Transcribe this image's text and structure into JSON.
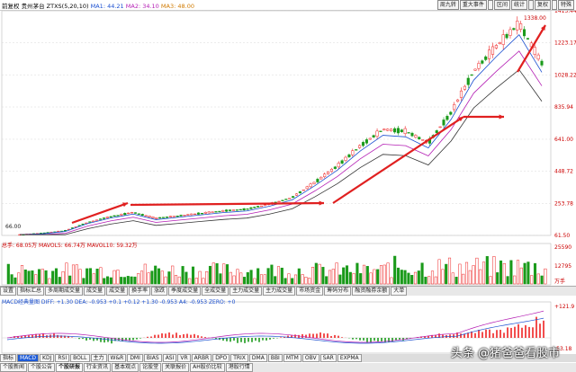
{
  "header": {
    "mode": "前复权",
    "stock": "贵州茅台",
    "ztxs": "ZTXS(5,20,10)",
    "ma1": "MA1: 44.21",
    "ma2": "MA2: 34.10",
    "ma3": "MA3: 48.00",
    "buttons": [
      "周九转",
      "重大事件",
      "",
      "区间",
      "统计",
      "",
      "复权",
      "",
      "特殊"
    ]
  },
  "price_axis": [
    "1415.44",
    "1223.17",
    "1028.22",
    "835.94",
    "641.00",
    "448.72",
    "253.78",
    "61.50"
  ],
  "price_max_label": "1338.00",
  "price_min_label": "66.00",
  "volume_header": "总手: 68.05万  MAVOL5: 66.74万  MAVOL10: 59.32万",
  "volume_axis": [
    "25590",
    "12795"
  ],
  "volume_unit": "万手",
  "macd_header": "MACD经典量图  DIFF: +1.30  DEA: -0.953  +0.1  +0.12  +1.30  -0.953  A4: -0.953  ZERO: +0",
  "macd_axis": [
    "+121.9",
    "-53.18"
  ],
  "tabs1": [
    "设置",
    "指标汇总",
    "多周期成交量",
    "成交量",
    "成交量",
    "换手率",
    "涨跌",
    "季度成交量",
    "全成交量",
    "主力成交量",
    "主力成交量",
    "市场资金",
    "筹码分布",
    "融资融券余额",
    "大单"
  ],
  "indicators": [
    "指标",
    "MACD",
    "KDJ",
    "RSI",
    "BOLL",
    "主力",
    "W&R",
    "DMI",
    "BIAS",
    "ASI",
    "VR",
    "ARBR",
    "DPO",
    "TRIX",
    "DMA",
    "BBI",
    "MTM",
    "OBV",
    "SAR",
    "EXPMA"
  ],
  "bottom_tabs": [
    "个股新闻",
    "个股公告",
    "个股研报",
    "行业资讯",
    "基本观点",
    "论股堂",
    "关联报价",
    "AH股价比较",
    "港股行情"
  ],
  "watermark": "头条 @猪爸爸看股市",
  "chart_data": {
    "type": "line",
    "series": [
      {
        "name": "",
        "values": [
          66,
          75,
          90,
          140,
          175,
          200,
          165,
          180,
          195,
          210,
          220,
          250,
          290,
          380,
          480,
          600,
          700,
          690,
          620,
          800,
          1050,
          1200,
          1338,
          1100
        ]
      }
    ],
    "ylim": [
      61.5,
      1415.44
    ]
  }
}
